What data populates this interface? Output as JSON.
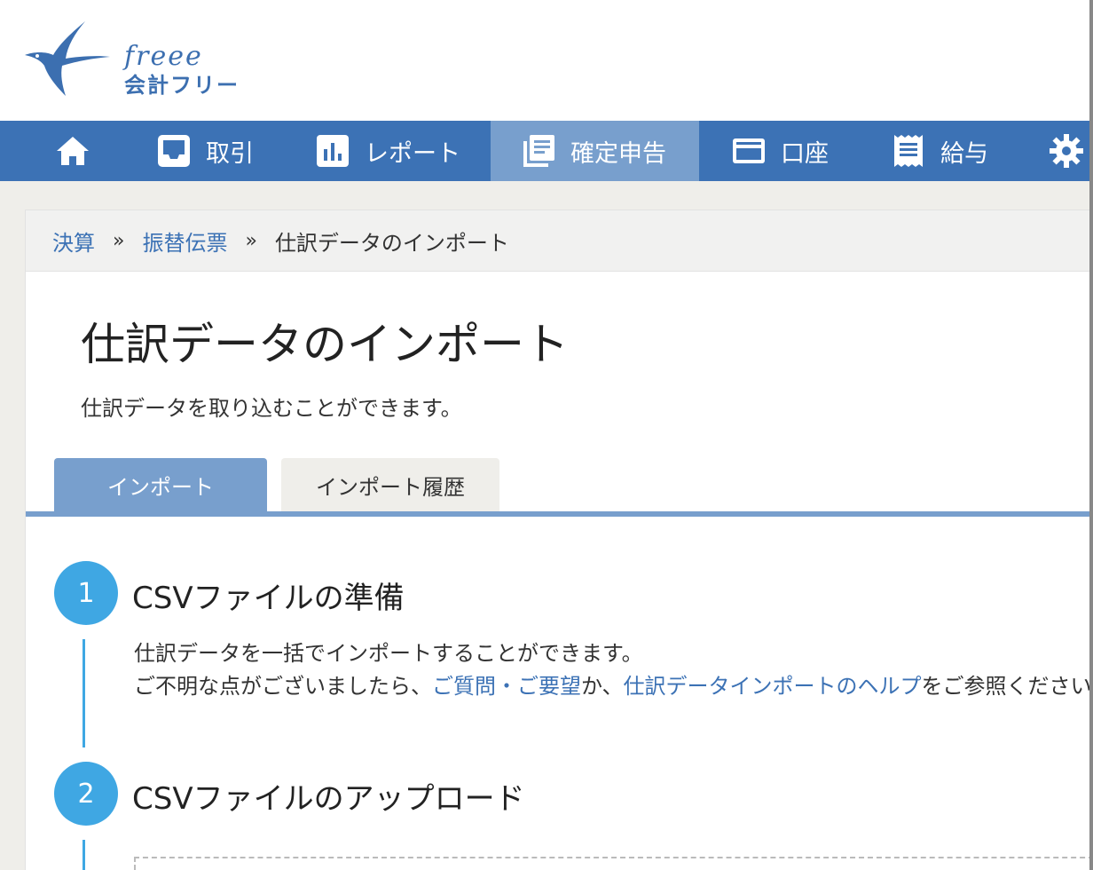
{
  "logo": {
    "script": "freee",
    "name": "会計フリー"
  },
  "nav": {
    "items": [
      {
        "label": "",
        "icon": "home-icon"
      },
      {
        "label": "取引",
        "icon": "inbox-icon"
      },
      {
        "label": "レポート",
        "icon": "bar-chart-icon"
      },
      {
        "label": "確定申告",
        "icon": "documents-icon",
        "active": true
      },
      {
        "label": "口座",
        "icon": "credit-card-icon"
      },
      {
        "label": "給与",
        "icon": "receipt-icon"
      },
      {
        "label": "",
        "icon": "gear-icon"
      }
    ]
  },
  "breadcrumb": {
    "items": [
      "決算",
      "振替伝票"
    ],
    "separator": "»",
    "current": "仕訳データのインポート"
  },
  "page": {
    "title": "仕訳データのインポート",
    "description": "仕訳データを取り込むことができます。"
  },
  "tabs": {
    "import": "インポート",
    "history": "インポート履歴"
  },
  "steps": [
    {
      "number": "1",
      "title": "CSVファイルの準備",
      "line1": "仕訳データを一括でインポートすることができます。",
      "line2_prefix": "ご不明な点がございましたら、",
      "link1": "ご質問・ご要望",
      "line2_mid": "か、",
      "link2": "仕訳データインポートのヘルプ",
      "line2_suffix": "をご参照ください。"
    },
    {
      "number": "2",
      "title": "CSVファイルのアップロード"
    }
  ],
  "colors": {
    "nav_bg": "#3c72b5",
    "nav_active": "#789fcd",
    "step_accent": "#3fa7e3",
    "link": "#3c72b5"
  }
}
